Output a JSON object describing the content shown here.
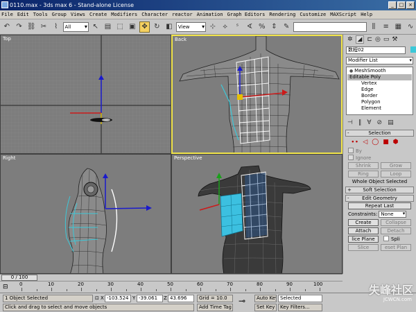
{
  "window": {
    "title": "0110.max - 3ds max 6 - Stand-alone License"
  },
  "menu": [
    "File",
    "Edit",
    "Tools",
    "Group",
    "Views",
    "Create",
    "Modifiers",
    "Character",
    "reactor",
    "Animation",
    "Graph Editors",
    "Rendering",
    "Customize",
    "MAXScript",
    "Help"
  ],
  "toolbar": {
    "selection_filter": "All",
    "reference_coord": "View"
  },
  "viewports": {
    "top": "Top",
    "back": "Back",
    "right": "Right",
    "perspective": "Perspective"
  },
  "command_panel": {
    "object_name": "数程02",
    "object_color": "#3cc8d8",
    "modifier_list": "Modifier List",
    "stack": [
      {
        "label": "MeshSmooth",
        "type": "modifier"
      },
      {
        "label": "Editable Poly",
        "type": "base",
        "selected": true
      },
      {
        "label": "Vertex",
        "type": "sub"
      },
      {
        "label": "Edge",
        "type": "sub"
      },
      {
        "label": "Border",
        "type": "sub"
      },
      {
        "label": "Polygon",
        "type": "sub"
      },
      {
        "label": "Element",
        "type": "sub"
      }
    ],
    "selection": {
      "title": "Selection",
      "by_vertex": "By",
      "ignore": "Ignore",
      "shrink": "Shrink",
      "grow": "Grow",
      "ring": "Ring",
      "loop": "Loop",
      "status": "Whole Object Selected"
    },
    "soft_selection": {
      "title": "Soft Selection"
    },
    "edit_geometry": {
      "title": "Edit Geometry",
      "repeat_last": "Repeat Last",
      "constraints_label": "Constraints:",
      "constraints_value": "None",
      "create": "Create",
      "collapse": "Collapse",
      "attach": "Attach",
      "detach": "Detach",
      "slice_plane": "lice Plane",
      "split": "Spli",
      "slice": "Slice",
      "reset_plane": "eset Plan"
    }
  },
  "timeline": {
    "frame_display": "0 / 100",
    "ticks": [
      "0",
      "10",
      "20",
      "30",
      "40",
      "50",
      "60",
      "70",
      "80",
      "90",
      "100"
    ]
  },
  "status": {
    "selection": "1 Object Selected",
    "prompt": "Click and drag to select and move objects",
    "x_label": "X",
    "x_value": "-103.524",
    "y_label": "Y",
    "y_value": "-39.061",
    "z_label": "Z",
    "z_value": "43.696",
    "grid": "Grid = 10.0",
    "add_time_tag": "Add Time Tag",
    "auto_key": "Auto Key",
    "set_key": "Set Key",
    "selected_mode": "Selected",
    "key_filters": "Key Filters..."
  },
  "watermark": {
    "text": "失峰社区",
    "sub": "JCWCN.com"
  }
}
